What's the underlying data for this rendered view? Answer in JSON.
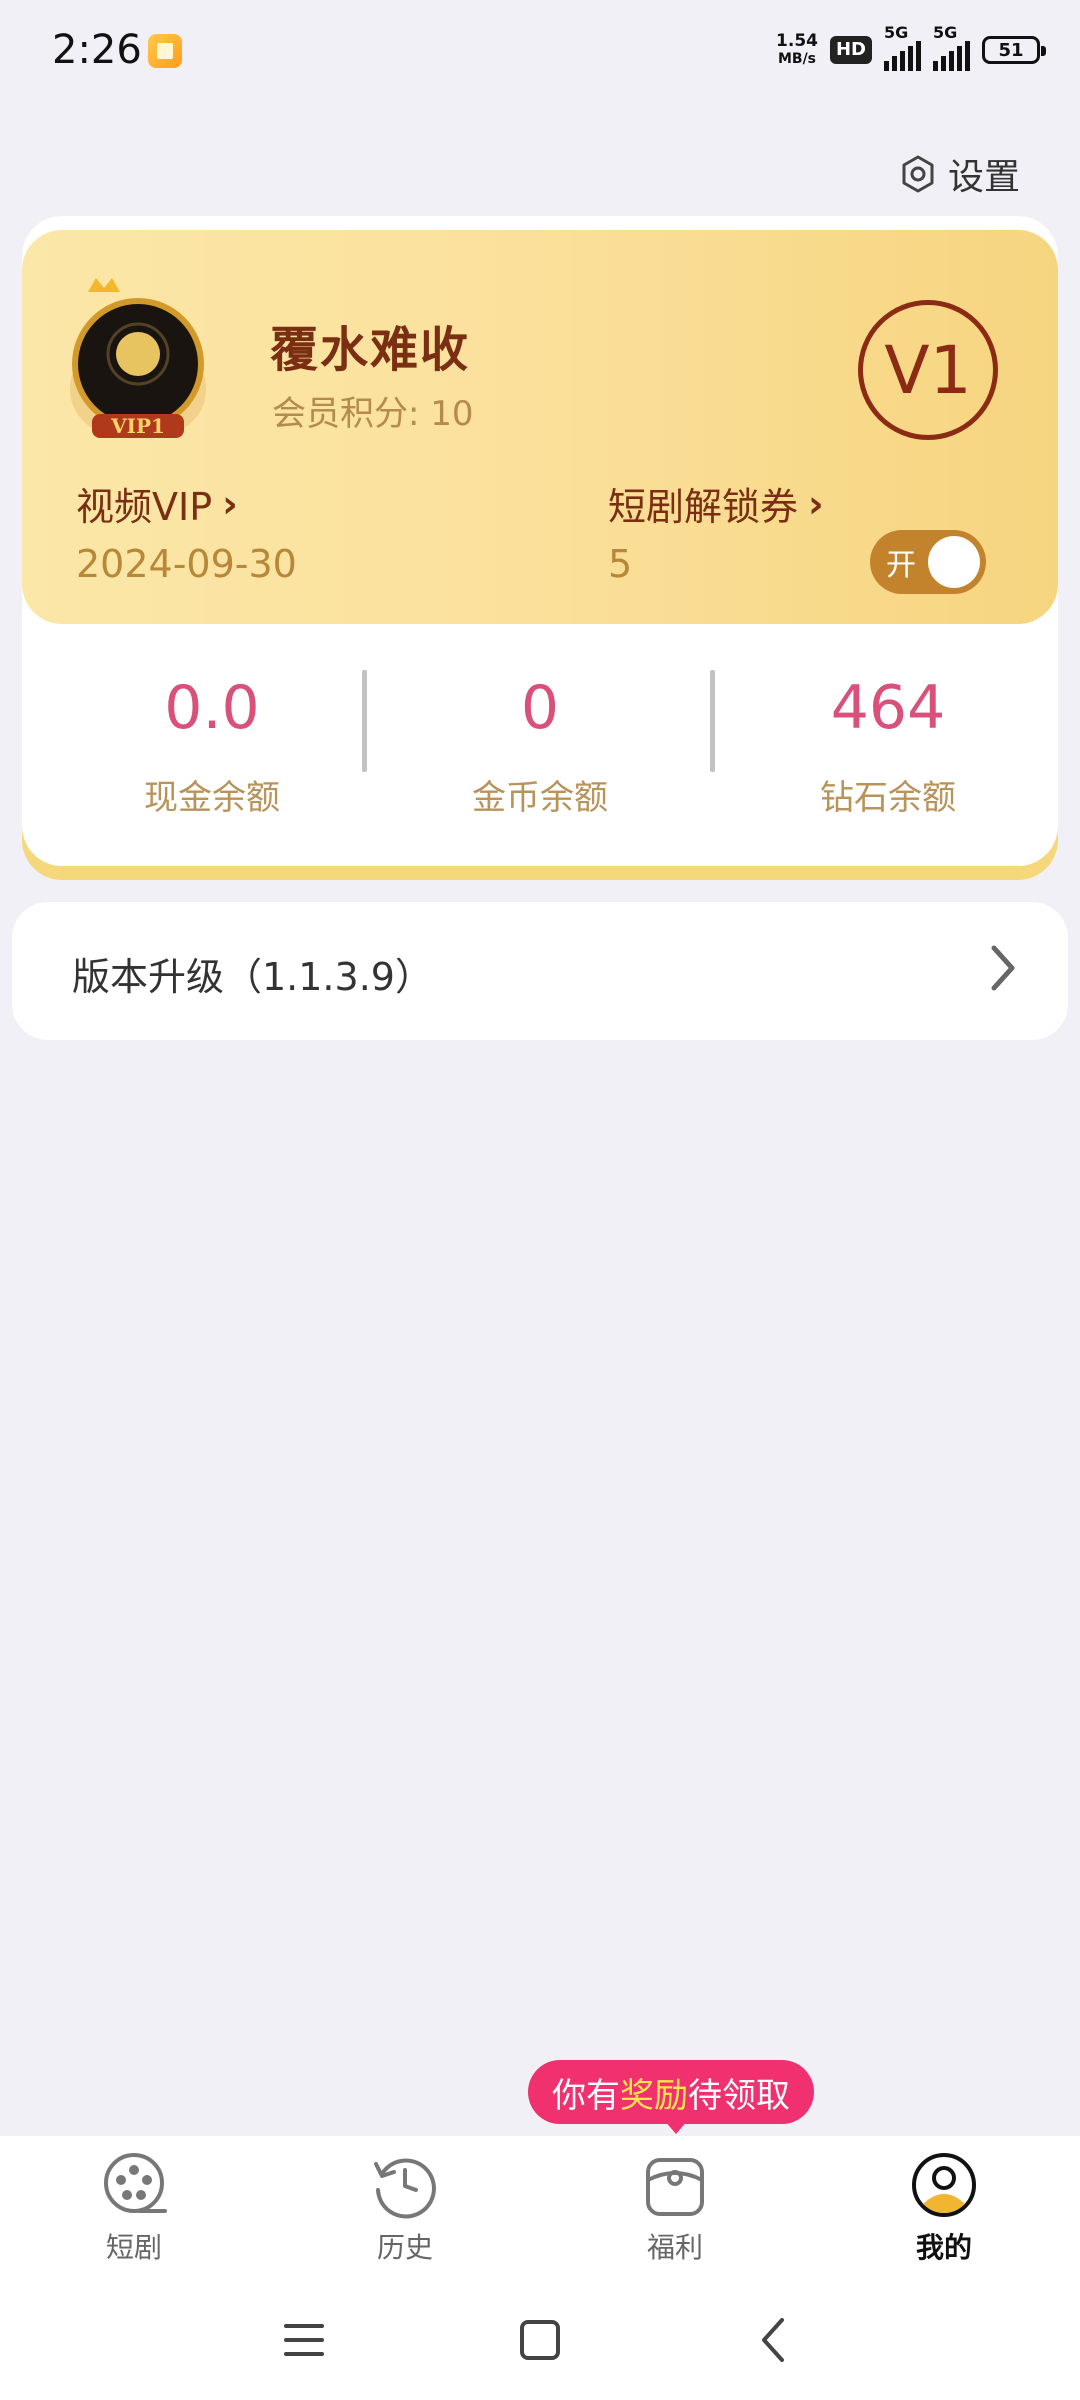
{
  "status_bar": {
    "time": "2:26",
    "net_speed_value": "1.54",
    "net_speed_unit": "MB/s",
    "hd_badge": "HD",
    "signal_1_label": "5G",
    "signal_2_label": "5G",
    "battery": "51"
  },
  "header": {
    "settings_label": "设置"
  },
  "profile": {
    "username": "覆水难收",
    "points_label": "会员积分: 10",
    "level_badge": "V1",
    "avatar_badge_text": "VIP1",
    "video_vip_label": "视频VIP",
    "video_vip_expiry": "2024-09-30",
    "coupon_label": "短剧解锁券",
    "coupon_count": "5",
    "toggle_label": "开",
    "toggle_on": true
  },
  "balances": [
    {
      "value": "0.0",
      "label": "现金余额"
    },
    {
      "value": "0",
      "label": "金币余额"
    },
    {
      "value": "464",
      "label": "钻石余额"
    }
  ],
  "version_row": {
    "label": "版本升级（1.1.3.9）"
  },
  "reward_tip": {
    "prefix": "你有",
    "highlight": "奖励",
    "suffix": "待领取"
  },
  "bottom_nav": {
    "items": [
      {
        "label": "短剧",
        "icon": "film-reel-icon"
      },
      {
        "label": "历史",
        "icon": "history-clock-icon"
      },
      {
        "label": "福利",
        "icon": "gift-bag-icon"
      },
      {
        "label": "我的",
        "icon": "profile-icon",
        "active": true
      }
    ]
  },
  "colors": {
    "accent_pink": "#d9507a",
    "vip_gold": "#fbe09b",
    "vip_brown": "#7a2e12",
    "reward_pink": "#f0306f"
  }
}
